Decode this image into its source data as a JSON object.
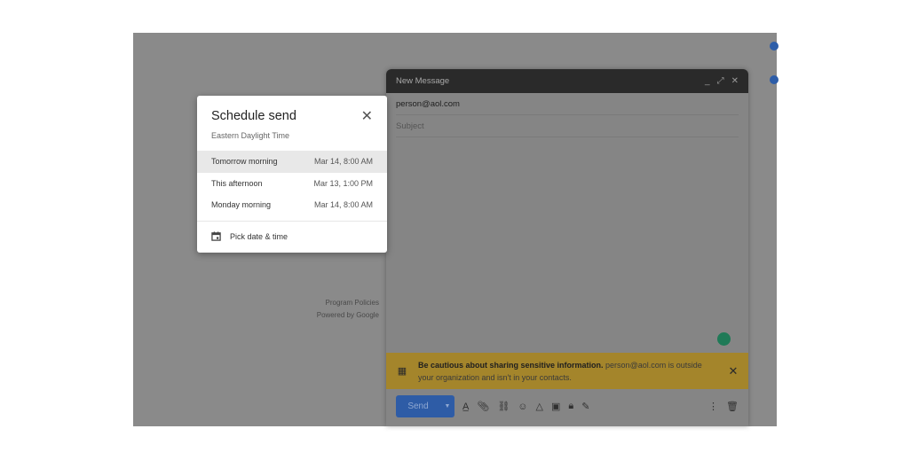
{
  "background": {
    "footer": [
      "Program Policies",
      "Powered by Google"
    ]
  },
  "compose": {
    "title": "New Message",
    "controls": {
      "minimize": "_",
      "expand": "⤢",
      "close": "✕"
    },
    "to": "person@aol.com",
    "subject_placeholder": "Subject",
    "banner": {
      "bold": "Be cautious about sharing sensitive information.",
      "text": " person@aol.com is outside your organization and isn't in your contacts."
    },
    "send_label": "Send",
    "colors": {
      "send": "#2e5ca6",
      "banner": "#a4852b",
      "header": "#2a2a2a"
    }
  },
  "schedule": {
    "title": "Schedule send",
    "timezone": "Eastern Daylight Time",
    "options": [
      {
        "label": "Tomorrow morning",
        "time": "Mar 14, 8:00 AM"
      },
      {
        "label": "This afternoon",
        "time": "Mar 13, 1:00 PM"
      },
      {
        "label": "Monday morning",
        "time": "Mar 14, 8:00 AM"
      }
    ],
    "pick_label": "Pick date & time"
  }
}
